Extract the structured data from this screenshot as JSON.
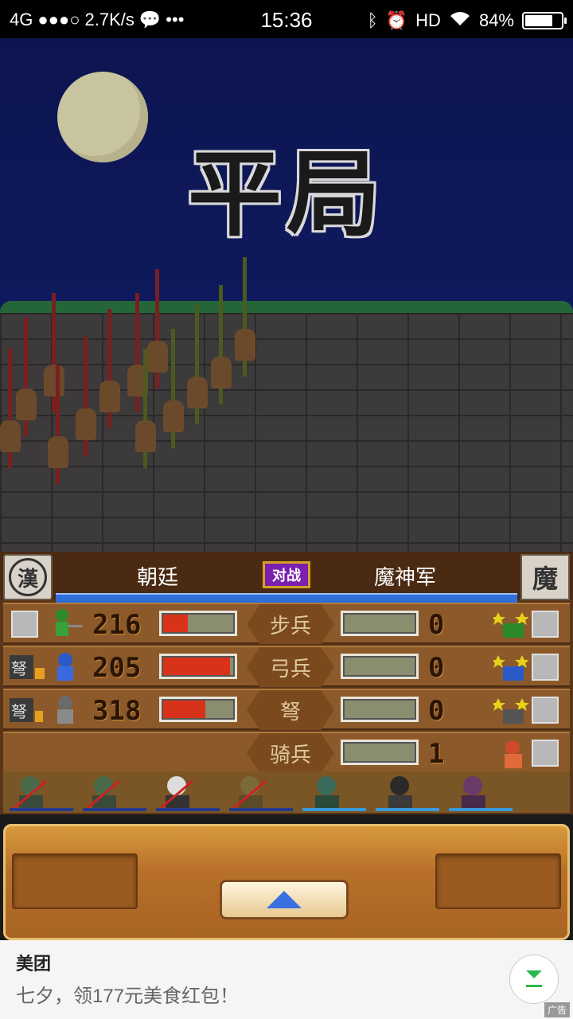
{
  "status_bar": {
    "network": "4G",
    "speed": "2.7K/s",
    "time": "15:36",
    "hd": "HD",
    "battery": "84%",
    "battery_level": 0.84
  },
  "scene": {
    "result_text": "平局"
  },
  "battle": {
    "left_faction": "朝廷",
    "left_badge": "漢",
    "vs_label": "对战",
    "right_faction": "魔神军",
    "right_badge": "魔",
    "rows": [
      {
        "unit": "步兵",
        "left_count": "216",
        "left_fill": 0.35,
        "right_count": "0"
      },
      {
        "unit": "弓兵",
        "left_count": "205",
        "left_fill": 0.95,
        "right_count": "0"
      },
      {
        "unit": "弩",
        "left_count": "318",
        "left_fill": 0.6,
        "right_count": "0"
      },
      {
        "unit": "骑兵",
        "left_count": "",
        "left_fill": 0,
        "right_count": "1"
      }
    ]
  },
  "ad": {
    "title": "美团",
    "subtitle": "七夕，领177元美食红包！",
    "tag": "广告"
  },
  "colors": {
    "sky": "#0e1a5e",
    "panel": "#5a3518",
    "gauge_fill": "#d9321a",
    "strength_bar": "#2f6ed6"
  }
}
